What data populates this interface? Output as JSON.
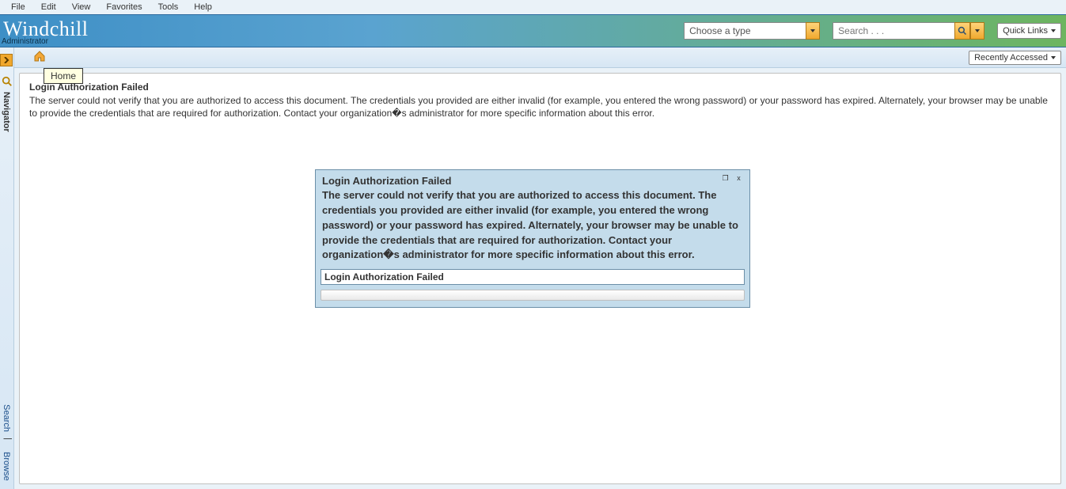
{
  "menu": {
    "items": [
      "File",
      "Edit",
      "View",
      "Favorites",
      "Tools",
      "Help"
    ]
  },
  "brand": {
    "name": "Windchill",
    "role": "Administrator"
  },
  "typechooser": {
    "placeholder": "Choose a type"
  },
  "search": {
    "placeholder": "Search . . ."
  },
  "quicklinks": {
    "label": "Quick Links"
  },
  "recent": {
    "label": "Recently Accessed"
  },
  "tooltip": {
    "text": "Home"
  },
  "sidebar": {
    "title": "Navigator",
    "search_link": "Search",
    "browse_link": "Browse",
    "sep": "|"
  },
  "error": {
    "title": "Login Authorization Failed",
    "body": "The server could not verify that you are authorized to access this document. The credentials you provided are either invalid (for example, you entered the wrong password) or your password has expired. Alternately, your browser may be unable to provide the credentials that are required for authorization. Contact your organization�s administrator for more specific information about this error."
  },
  "dialog": {
    "title": "Login Authorization Failed",
    "body": "The server could not verify that you are authorized to access this document. The credentials you provided are either invalid (for example, you entered the wrong password) or your password has expired. Alternately, your browser may be unable to provide the credentials that are required for authorization. Contact your organization�s administrator for more specific information about this error.",
    "status_field": "Login Authorization Failed",
    "min_glyph": "❐",
    "close_glyph": "x"
  }
}
